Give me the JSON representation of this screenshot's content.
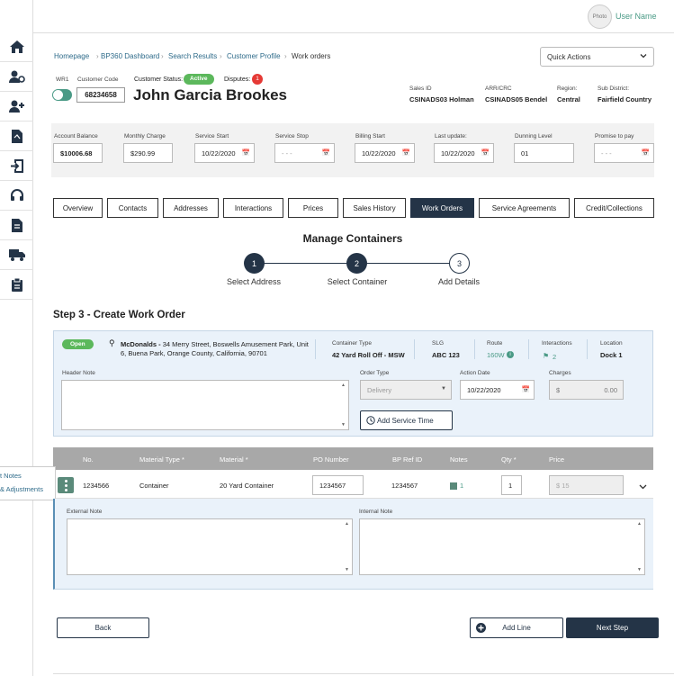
{
  "header": {
    "avatar_text": "Photo",
    "username": "User Name"
  },
  "sidebar": {
    "icons": [
      "home-icon",
      "users-gear-icon",
      "add-user-icon",
      "pdf-icon",
      "import-icon",
      "headset-icon",
      "document-icon",
      "truck-icon",
      "clipboard-icon"
    ]
  },
  "breadcrumb": [
    "Homepage",
    "BP360 Dashboard",
    "Search Results",
    "Customer Profile",
    "Work orders"
  ],
  "quick_actions": "Quick Actions",
  "customer": {
    "wr_label": "WR1",
    "code_label": "Customer Code",
    "code": "68234658",
    "name": "John Garcia Brookes",
    "status_label": "Customer Status:",
    "status": "Active",
    "disputes_label": "Disputes:",
    "disputes": "1",
    "sales_id_label": "Sales ID",
    "sales_id": "CSINADS03 Holman",
    "arr_label": "ARR/CRC",
    "arr": "CSINADS05 Bendel",
    "region_label": "Region:",
    "region": "Central",
    "subdistrict_label": "Sub District:",
    "subdistrict": "Fairfield Country"
  },
  "account": {
    "balance_label": "Account Balance",
    "balance": "$10006.68",
    "monthly_label": "Monthly Charge",
    "monthly": "$290.99",
    "start_label": "Service Start",
    "start": "10/22/2020",
    "stop_label": "Service Stop",
    "stop": "- - -",
    "billing_label": "Billing Start",
    "billing": "10/22/2020",
    "update_label": "Last update:",
    "update": "10/22/2020",
    "dunning_label": "Dunning Level",
    "dunning": "01",
    "promise_label": "Promise to pay",
    "promise": "- - -"
  },
  "tabs": [
    "Overview",
    "Contacts",
    "Addresses",
    "Interactions",
    "Prices",
    "Sales History",
    "Work Orders",
    "Service Agreements",
    "Credit/Collections"
  ],
  "manage": {
    "title": "Manage Containers",
    "steps": [
      {
        "n": "1",
        "label": "Select Address"
      },
      {
        "n": "2",
        "label": "Select Container"
      },
      {
        "n": "3",
        "label": "Add Details"
      }
    ]
  },
  "step3": {
    "title": "Step 3 - Create Work Order"
  },
  "work": {
    "status": "Open",
    "location_name": "McDonalds -",
    "address": "34 Merry Street, Boswells Amusement Park, Unit 6, Buena Park, Orange County, California, 90701",
    "ctype_label": "Container Type",
    "ctype": "42 Yard Roll Off - MSW",
    "slg_label": "SLG",
    "slg": "ABC 123",
    "route_label": "Route",
    "route": "160W",
    "inter_label": "Interactions",
    "inter": "2",
    "loc_label": "Location",
    "loc": "Dock 1",
    "header_note_label": "Header Note",
    "order_type_label": "Order Type",
    "order_type": "Delivery",
    "action_label": "Action Date",
    "action": "10/22/2020",
    "charges_label": "Charges",
    "charges_currency": "$",
    "charges": "0.00",
    "add_service": "Add Service Time"
  },
  "table": {
    "cols": [
      "No.",
      "Material Type *",
      "Material *",
      "PO Number",
      "BP Ref ID",
      "Notes",
      "Qty *",
      "Price"
    ],
    "row": {
      "no": "1234566",
      "mtype": "Container",
      "material": "20 Yard Container",
      "po": "1234567",
      "bpref": "1234567",
      "notes": "1",
      "qty": "1",
      "price_currency": "$",
      "price": "15"
    },
    "side_labels": [
      "t Notes",
      "& Adjustments"
    ],
    "ext_label": "External Note",
    "int_label": "Internal Note"
  },
  "footer": {
    "back": "Back",
    "add_line": "Add Line",
    "next": "Next Step"
  },
  "colors": {
    "navy": "#243447",
    "green": "#5cb85c",
    "teal": "#4a9a86"
  }
}
